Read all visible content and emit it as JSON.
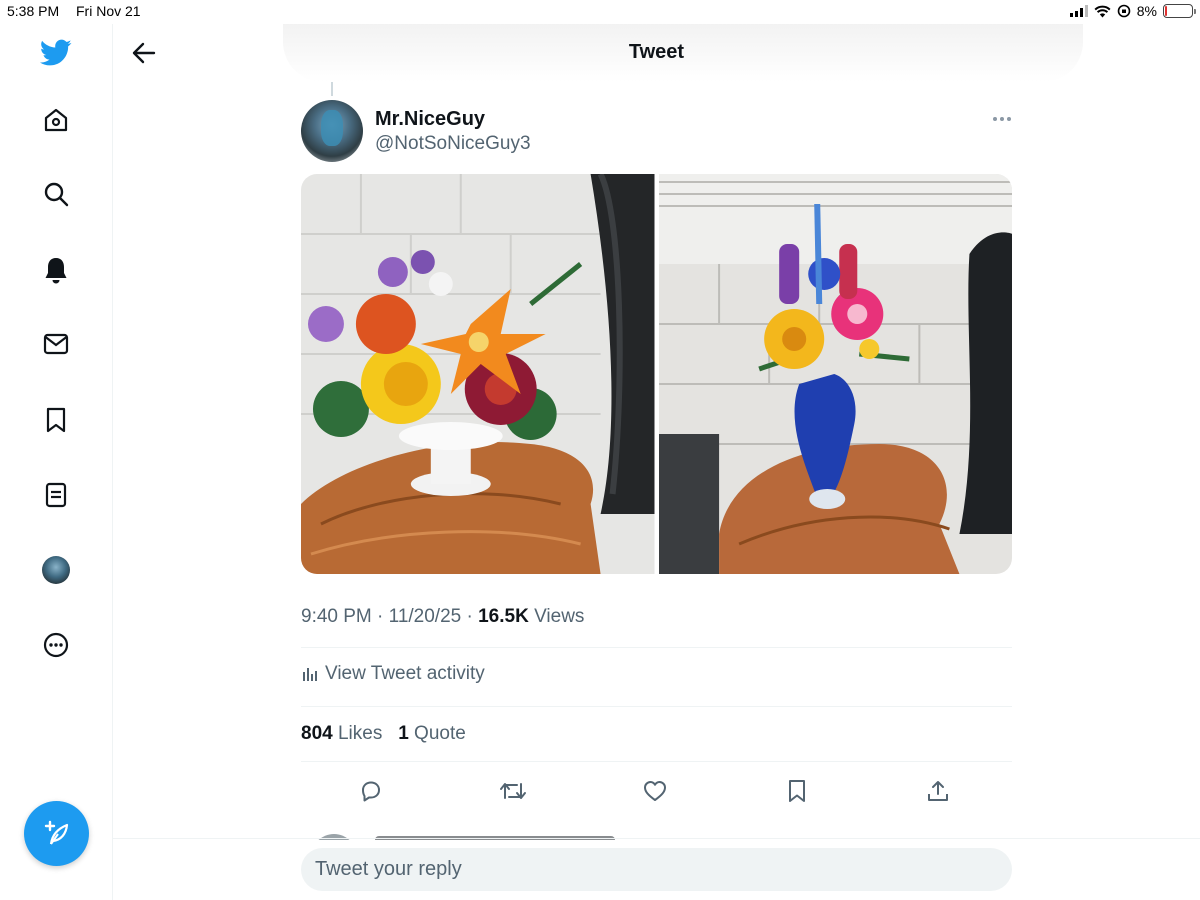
{
  "status_bar": {
    "time": "5:38 PM",
    "date": "Fri Nov 21",
    "battery_percent": "8%",
    "battery_level": 0.08
  },
  "sidebar": {
    "items": [
      {
        "name": "twitter-logo-icon",
        "icon": "twitter-bird"
      },
      {
        "name": "home-icon",
        "icon": "home"
      },
      {
        "name": "search-icon",
        "icon": "search"
      },
      {
        "name": "notifications-icon",
        "icon": "bell"
      },
      {
        "name": "messages-icon",
        "icon": "mail"
      },
      {
        "name": "bookmarks-icon",
        "icon": "bookmark"
      },
      {
        "name": "lists-icon",
        "icon": "list"
      },
      {
        "name": "profile-avatar",
        "icon": "avatar"
      },
      {
        "name": "more-icon",
        "icon": "more-circle"
      }
    ],
    "compose_icon": "feather-plus"
  },
  "header": {
    "title": "Tweet",
    "back_icon": "arrow-left"
  },
  "tweet": {
    "display_name": "Mr.NiceGuy",
    "handle": "@NotSoNiceGuy3",
    "time": "9:40 PM",
    "date": "11/20/25",
    "views_count": "16.5K",
    "views_label": "Views",
    "activity_label": "View Tweet activity",
    "likes_count": "804",
    "likes_label": "Likes",
    "quotes_count": "1",
    "quotes_label": "Quote",
    "actions": [
      "reply-icon",
      "retweet-icon",
      "like-icon",
      "bookmark-icon",
      "share-icon"
    ]
  },
  "reply": {
    "placeholder": "Tweet your reply"
  },
  "colors": {
    "accent": "#1d9bf0",
    "text_primary": "#0f1419",
    "text_secondary": "#536471",
    "divider": "#eff3f4",
    "battery_low": "#e0312f"
  }
}
